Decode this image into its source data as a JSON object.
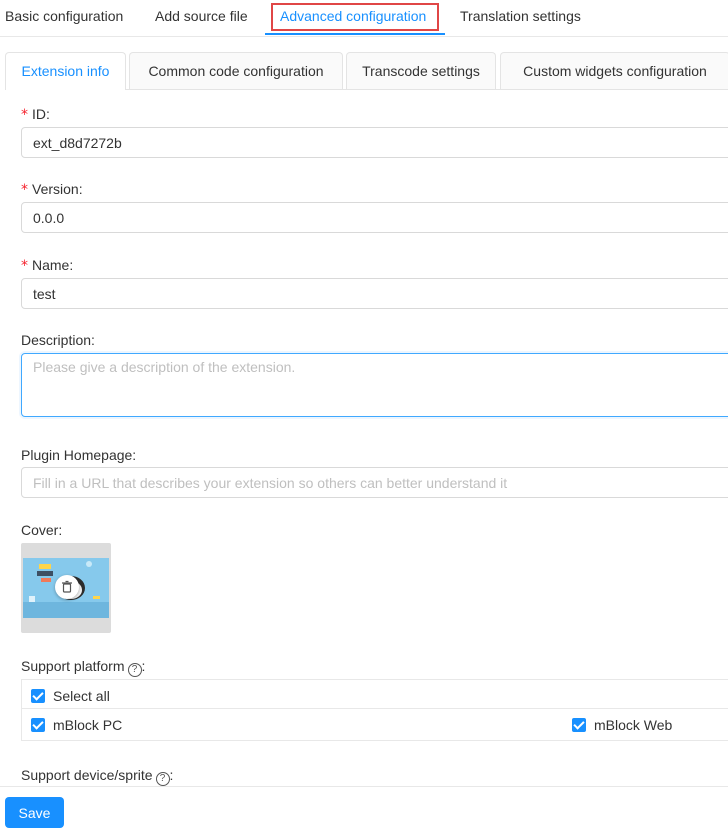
{
  "top_tabs": [
    {
      "label": "Basic configuration"
    },
    {
      "label": "Add source file"
    },
    {
      "label": "Advanced configuration",
      "active": true
    },
    {
      "label": "Translation settings"
    }
  ],
  "sub_tabs": [
    {
      "label": "Extension info",
      "active": true
    },
    {
      "label": "Common code configuration"
    },
    {
      "label": "Transcode settings"
    },
    {
      "label": "Custom widgets configuration"
    }
  ],
  "form": {
    "id": {
      "label": "ID:",
      "value": "ext_d8d7272b",
      "required": true
    },
    "version": {
      "label": "Version:",
      "value": "0.0.0",
      "required": true
    },
    "name": {
      "label": "Name:",
      "value": "test",
      "required": true
    },
    "description": {
      "label": "Description:",
      "placeholder": "Please give a description of the extension."
    },
    "homepage": {
      "label": "Plugin Homepage:",
      "placeholder": "Fill in a URL that describes your extension so others can better understand it"
    },
    "cover": {
      "label": "Cover:",
      "delete_icon": "trash-icon"
    },
    "support_platform": {
      "label": "Support platform",
      "label_suffix": ":",
      "help_icon": "question-circle-icon",
      "select_all": {
        "label": "Select all",
        "checked": true
      },
      "options": [
        {
          "label": "mBlock PC",
          "checked": true
        },
        {
          "label": "mBlock Web",
          "checked": true
        }
      ]
    },
    "support_device": {
      "label": "Support device/sprite",
      "label_suffix": ":",
      "help_icon": "question-circle-icon"
    }
  },
  "footer": {
    "save_label": "Save"
  },
  "colors": {
    "primary": "#1890ff",
    "required": "#f5222d",
    "highlight_box": "#e04646"
  }
}
